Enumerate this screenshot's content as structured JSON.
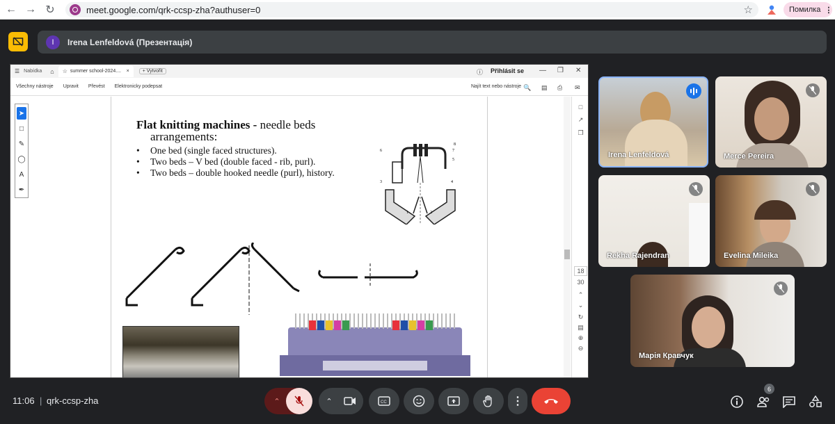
{
  "browser": {
    "url": "meet.google.com/qrk-ccsp-zha?authuser=0",
    "error_label": "Помилка"
  },
  "presenter": {
    "avatar_letter": "I",
    "label": "Irena Lenfeldová (Презентація)"
  },
  "shared_screen": {
    "tab_home": "Nabídka",
    "tab_doc": "summer school-2024....",
    "tab_close": "×",
    "tab_new": "+ Vytvořit",
    "sign_in": "Přihlásit se",
    "menu": [
      "Všechny nástroje",
      "Upravit",
      "Převést",
      "Elektronicky podepsat"
    ],
    "find_text": "Najít text nebo nástroje",
    "page_number": "18",
    "page_total": "30",
    "slide": {
      "title_bold": "Flat knitting machines -",
      "title_rest": " needle beds",
      "title_line2": "arrangements:",
      "bullets": [
        "One bed (single faced structures).",
        "Two beds – V bed (double faced - rib, purl).",
        "Two beds – double hooked needle (purl), history."
      ],
      "diagram_numbers": [
        "8",
        "7",
        "6",
        "5",
        "3",
        "4",
        "1",
        "2"
      ]
    }
  },
  "participants": [
    {
      "name": "Irena Lenfeldová",
      "speaking": true
    },
    {
      "name": "Merce Pereira",
      "muted": true
    },
    {
      "name": "Rekha Rajendran",
      "muted": true
    },
    {
      "name": "Evelina Mileika",
      "muted": true
    },
    {
      "name": "Марія Кравчук",
      "muted": true
    }
  ],
  "bottom": {
    "time": "11:06",
    "separator": "|",
    "meeting_code": "qrk-ccsp-zha",
    "people_count": "6"
  },
  "colors": {
    "background": "#202124",
    "end_call": "#ea4335",
    "mic_off": "#f9dedc",
    "present_icon": "#fbbc04",
    "active_speaker": "#8ab4f8"
  }
}
